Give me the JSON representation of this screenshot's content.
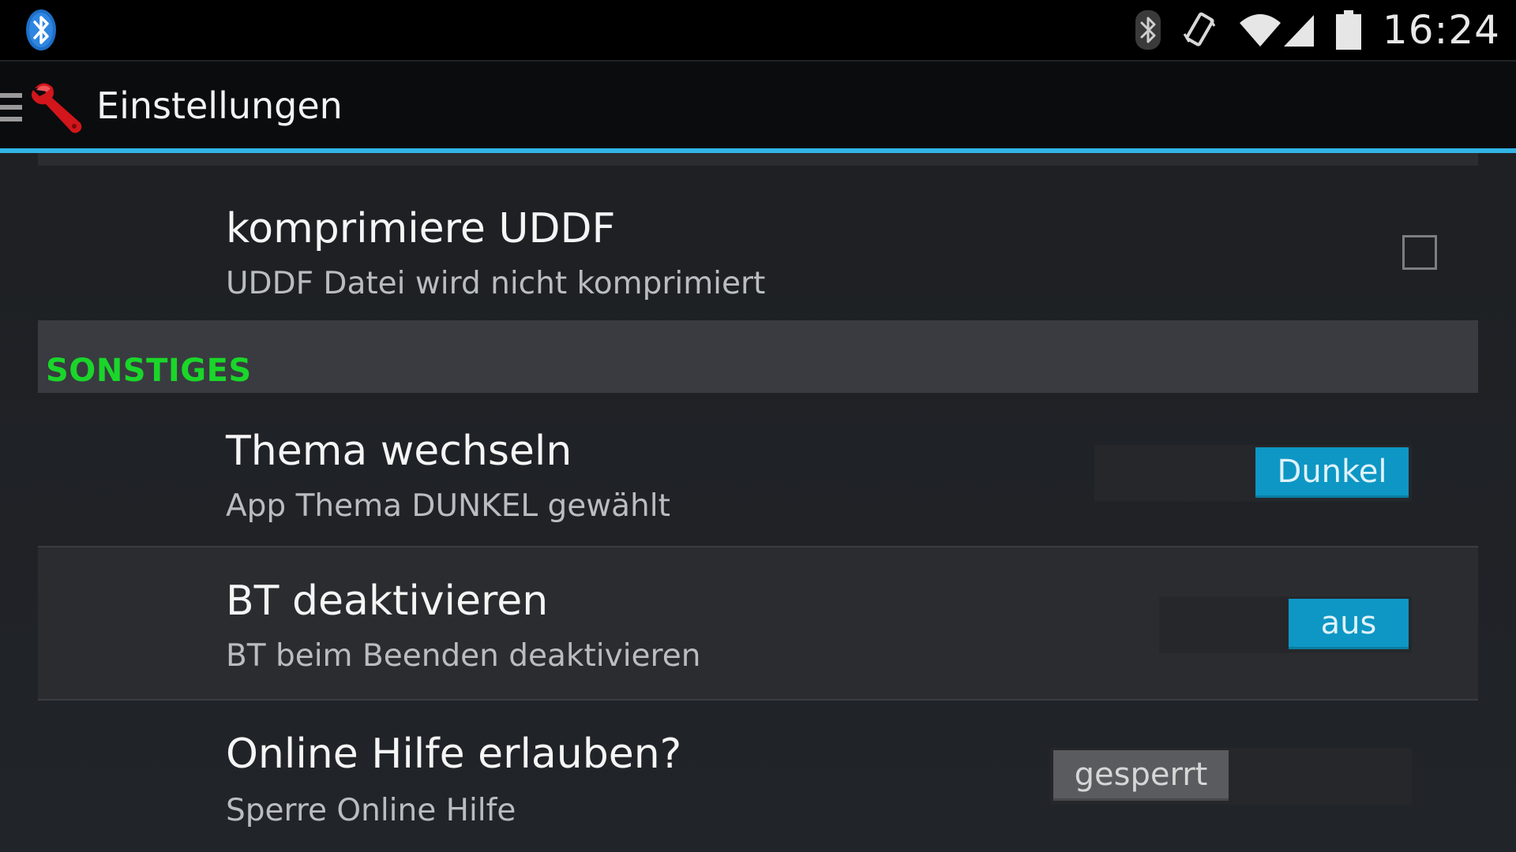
{
  "status_bar": {
    "time": "16:24",
    "icons": [
      "bluetooth-app-icon",
      "bluetooth-icon",
      "vibrate-icon",
      "wifi-icon",
      "signal-icon",
      "battery-icon"
    ]
  },
  "action_bar": {
    "title": "Einstellungen",
    "app_icon": "wrench-icon",
    "drawer_icon": "menu-icon"
  },
  "preferences": {
    "uddf": {
      "title": "komprimiere UDDF",
      "summary": "UDDF Datei wird nicht komprimiert",
      "checked": false
    },
    "category_misc": {
      "label": "SONSTIGES"
    },
    "theme": {
      "title": "Thema wechseln",
      "summary": "App Thema DUNKEL gewählt",
      "toggle_text": "Dunkel",
      "toggle_on": true
    },
    "bt": {
      "title": "BT deaktivieren",
      "summary": "BT beim Beenden deaktivieren",
      "toggle_text": "aus",
      "toggle_on": true
    },
    "help": {
      "title": "Online Hilfe erlauben?",
      "summary": "Sperre Online Hilfe",
      "toggle_text": "gesperrt",
      "toggle_on": false
    }
  },
  "colors": {
    "accent": "#33b5e5",
    "category_text": "#1ad62a",
    "toggle_on": "#0e97c4",
    "toggle_off": "#595b5f"
  }
}
